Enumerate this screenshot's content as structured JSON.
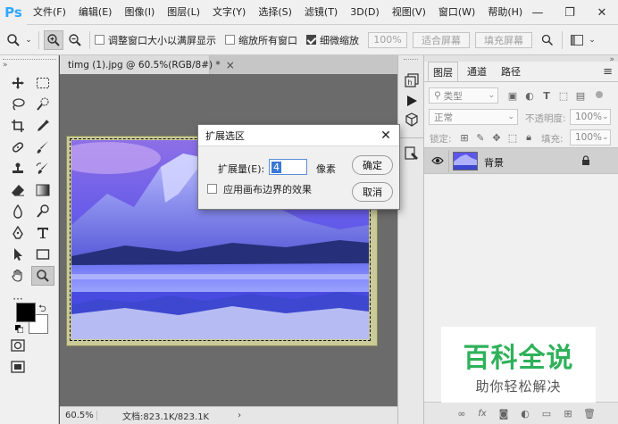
{
  "app": {
    "logo": "Ps"
  },
  "menubar": {
    "items": [
      "文件(F)",
      "编辑(E)",
      "图像(I)",
      "图层(L)",
      "文字(Y)",
      "选择(S)",
      "滤镜(T)",
      "3D(D)",
      "视图(V)",
      "窗口(W)",
      "帮助(H)"
    ],
    "win_minimize": "—",
    "win_restore": "❐",
    "win_close": "✕"
  },
  "options": {
    "resize_windows": "调整窗口大小以满屏显示",
    "zoom_all": "缩放所有窗口",
    "scrubby_zoom": "细微缩放",
    "scrubby_checked": true,
    "zoom_100": "100%",
    "fit_screen": "适合屏幕",
    "fill_screen": "填充屏幕"
  },
  "document": {
    "tab_title": "timg (1).jpg @ 60.5%(RGB/8#) *",
    "tab_close": "×",
    "zoom": "60.5%",
    "doc_info": "文档:823.1K/823.1K"
  },
  "tools": {
    "foreground": "#000000",
    "background": "#ffffff",
    "more": "···"
  },
  "layers_panel": {
    "tabs": [
      "图层",
      "通道",
      "路径"
    ],
    "filter_kind": "类型",
    "blend_mode": "正常",
    "opacity_label": "不透明度:",
    "opacity_value": "100%",
    "lock_label": "锁定:",
    "fill_label": "填充:",
    "fill_value": "100%",
    "layer_name": "背景",
    "menu_icon": "≡",
    "collapse_icon": "»"
  },
  "dialog": {
    "title": "扩展选区",
    "expand_label": "扩展量(E):",
    "expand_value": "4",
    "unit": "像素",
    "apply_canvas_bounds": "应用画布边界的效果",
    "apply_checked": false,
    "ok": "确定",
    "cancel": "取消",
    "close": "✕"
  },
  "watermark": {
    "title": "百科全说",
    "subtitle": "助你轻松解决",
    "title_color": "#2fb15a"
  },
  "colors": {
    "ps_blue": "#31a8ff",
    "canvas_gray": "#6b6b6b",
    "panel_bg": "#f0f0f0"
  }
}
